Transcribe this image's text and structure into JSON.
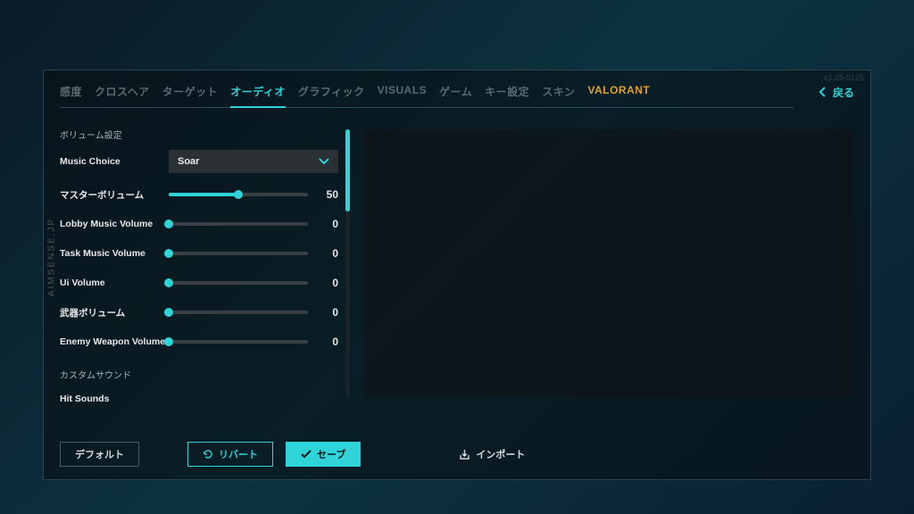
{
  "watermark": "AIMSENSE.JP",
  "version": "v1.25-5125",
  "tabs": [
    {
      "label": "感度",
      "state": "normal"
    },
    {
      "label": "クロスヘア",
      "state": "normal"
    },
    {
      "label": "ターゲット",
      "state": "normal"
    },
    {
      "label": "オーディオ",
      "state": "active"
    },
    {
      "label": "グラフィック",
      "state": "normal"
    },
    {
      "label": "VISUALS",
      "state": "normal"
    },
    {
      "label": "ゲーム",
      "state": "normal"
    },
    {
      "label": "キー設定",
      "state": "normal"
    },
    {
      "label": "スキン",
      "state": "normal"
    },
    {
      "label": "VALORANT",
      "state": "highlight"
    }
  ],
  "back_label": "戻る",
  "sections": {
    "volume_title": "ボリューム設定",
    "custom_title": "カスタムサウンド",
    "hit_sounds": "Hit Sounds"
  },
  "music_choice": {
    "label": "Music Choice",
    "value": "Soar"
  },
  "sliders": [
    {
      "label": "マスターボリューム",
      "value": 50
    },
    {
      "label": "Lobby Music Volume",
      "value": 0
    },
    {
      "label": "Task Music Volume",
      "value": 0
    },
    {
      "label": "Ui Volume",
      "value": 0
    },
    {
      "label": "武器ボリューム",
      "value": 0
    },
    {
      "label": "Enemy Weapon Volume",
      "value": 0
    }
  ],
  "buttons": {
    "default": "デフォルト",
    "revert": "リバート",
    "save": "セーブ",
    "import": "インポート"
  }
}
